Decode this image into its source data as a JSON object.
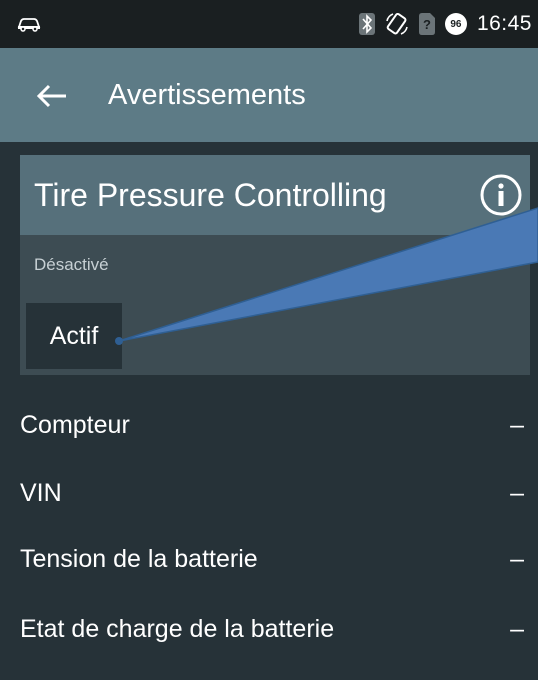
{
  "status_bar": {
    "time": "16:45",
    "battery_level": "96",
    "icons": [
      "car-icon",
      "bluetooth-icon",
      "screen-rotate-icon",
      "no-sim-icon",
      "battery-icon"
    ]
  },
  "app_bar": {
    "back_icon": "arrow-back-icon",
    "title": "Avertissements"
  },
  "card": {
    "title": "Tire Pressure Controlling",
    "info_icon": "info-icon",
    "status_text": "Désactivé",
    "action_label": "Actif"
  },
  "rows": [
    {
      "label": "Compteur",
      "value": "–"
    },
    {
      "label": "VIN",
      "value": "–"
    },
    {
      "label": "Tension de la batterie",
      "value": "–"
    },
    {
      "label": "Etat de charge de la batterie",
      "value": "–"
    }
  ],
  "colors": {
    "background": "#263238",
    "status_bar": "#1a1f21",
    "app_bar": "#5d7b86",
    "card_header": "#56707b",
    "card_body": "#3d4c53",
    "callout": "#4a79b5"
  }
}
